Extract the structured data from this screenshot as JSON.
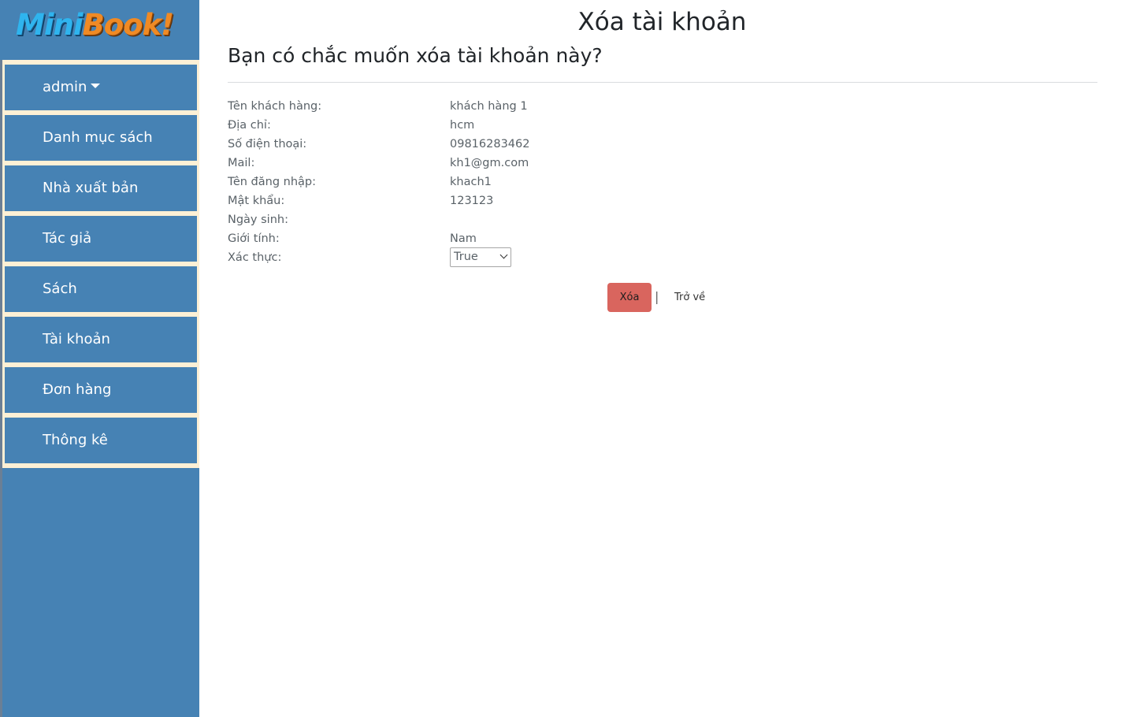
{
  "app": {
    "logo": {
      "part1": "Mini",
      "part2": "Book!"
    }
  },
  "sidebar": {
    "items": [
      {
        "label": "admin",
        "has_caret": true
      },
      {
        "label": "Danh mục sách"
      },
      {
        "label": "Nhà xuất bản"
      },
      {
        "label": "Tác giả"
      },
      {
        "label": "Sách"
      },
      {
        "label": "Tài khoản"
      },
      {
        "label": "Đơn hàng"
      },
      {
        "label": "Thông kê"
      }
    ]
  },
  "page": {
    "title": "Xóa tài khoản",
    "question": "Bạn có chắc muốn xóa tài khoản này?"
  },
  "details": {
    "customer_name": {
      "label": "Tên khách hàng:",
      "value": "khách hàng 1"
    },
    "address": {
      "label": "Địa chỉ:",
      "value": "hcm"
    },
    "phone": {
      "label": "Số điện thoại:",
      "value": "09816283462"
    },
    "mail": {
      "label": "Mail:",
      "value": "kh1@gm.com"
    },
    "username": {
      "label": "Tên đăng nhập:",
      "value": "khach1"
    },
    "password": {
      "label": "Mật khẩu:",
      "value": "123123"
    },
    "birthday": {
      "label": "Ngày sinh:",
      "value": ""
    },
    "gender": {
      "label": "Giới tính:",
      "value": "Nam"
    },
    "verified": {
      "label": "Xác thực:",
      "selected": "True"
    }
  },
  "actions": {
    "delete_label": "Xóa",
    "separator": "|",
    "back_label": "Trở về"
  },
  "colors": {
    "sidebar_bg": "#4682b4",
    "menu_border": "#fdf0d5",
    "delete_button": "#d9655e",
    "logo_mini": "#2fb4ee",
    "logo_book": "#f08a24"
  }
}
